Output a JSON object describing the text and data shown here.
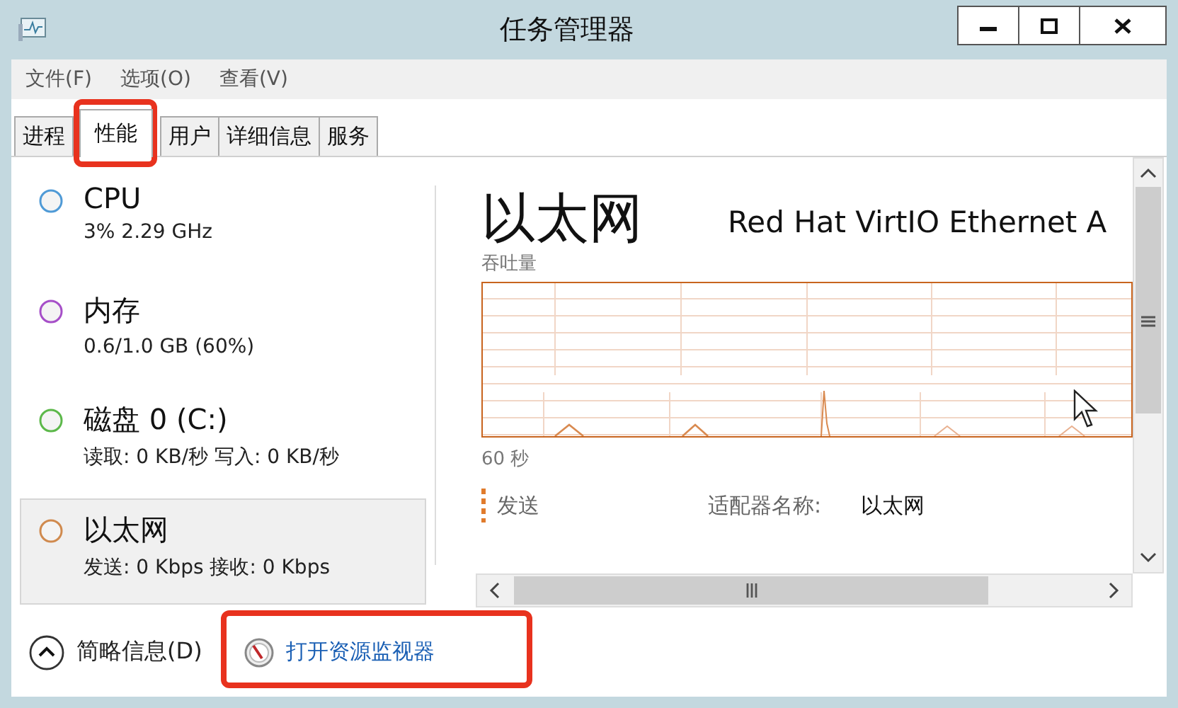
{
  "window": {
    "title": "任务管理器"
  },
  "menu": [
    "文件(F)",
    "选项(O)",
    "查看(V)"
  ],
  "tabs": [
    {
      "label": "进程",
      "selected": false
    },
    {
      "label": "性能",
      "selected": true
    },
    {
      "label": "用户",
      "selected": false
    },
    {
      "label": "详细信息",
      "selected": false
    },
    {
      "label": "服务",
      "selected": false
    }
  ],
  "sidebar": {
    "items": [
      {
        "name": "CPU",
        "detail": "3% 2.29 GHz",
        "color": "#4f9ad6",
        "selected": false
      },
      {
        "name": "内存",
        "detail": "0.6/1.0 GB (60%)",
        "color": "#a64fc8",
        "selected": false
      },
      {
        "name": "磁盘 0 (C:)",
        "detail": "读取: 0 KB/秒 写入: 0 KB/秒",
        "color": "#5cb84a",
        "selected": false
      },
      {
        "name": "以太网",
        "detail": "发送: 0 Kbps 接收: 0 Kbps",
        "color": "#d08a4e",
        "selected": true
      }
    ]
  },
  "detail": {
    "title": "以太网",
    "adapter": "Red Hat VirtIO Ethernet A",
    "chart_label": "吞吐量",
    "time_label": "60 秒",
    "stat_label": "发送",
    "property_label": "适配器名称:",
    "property_value": "以太网"
  },
  "footer": {
    "toggle": "简略信息(D)",
    "link": "打开资源监视器"
  }
}
